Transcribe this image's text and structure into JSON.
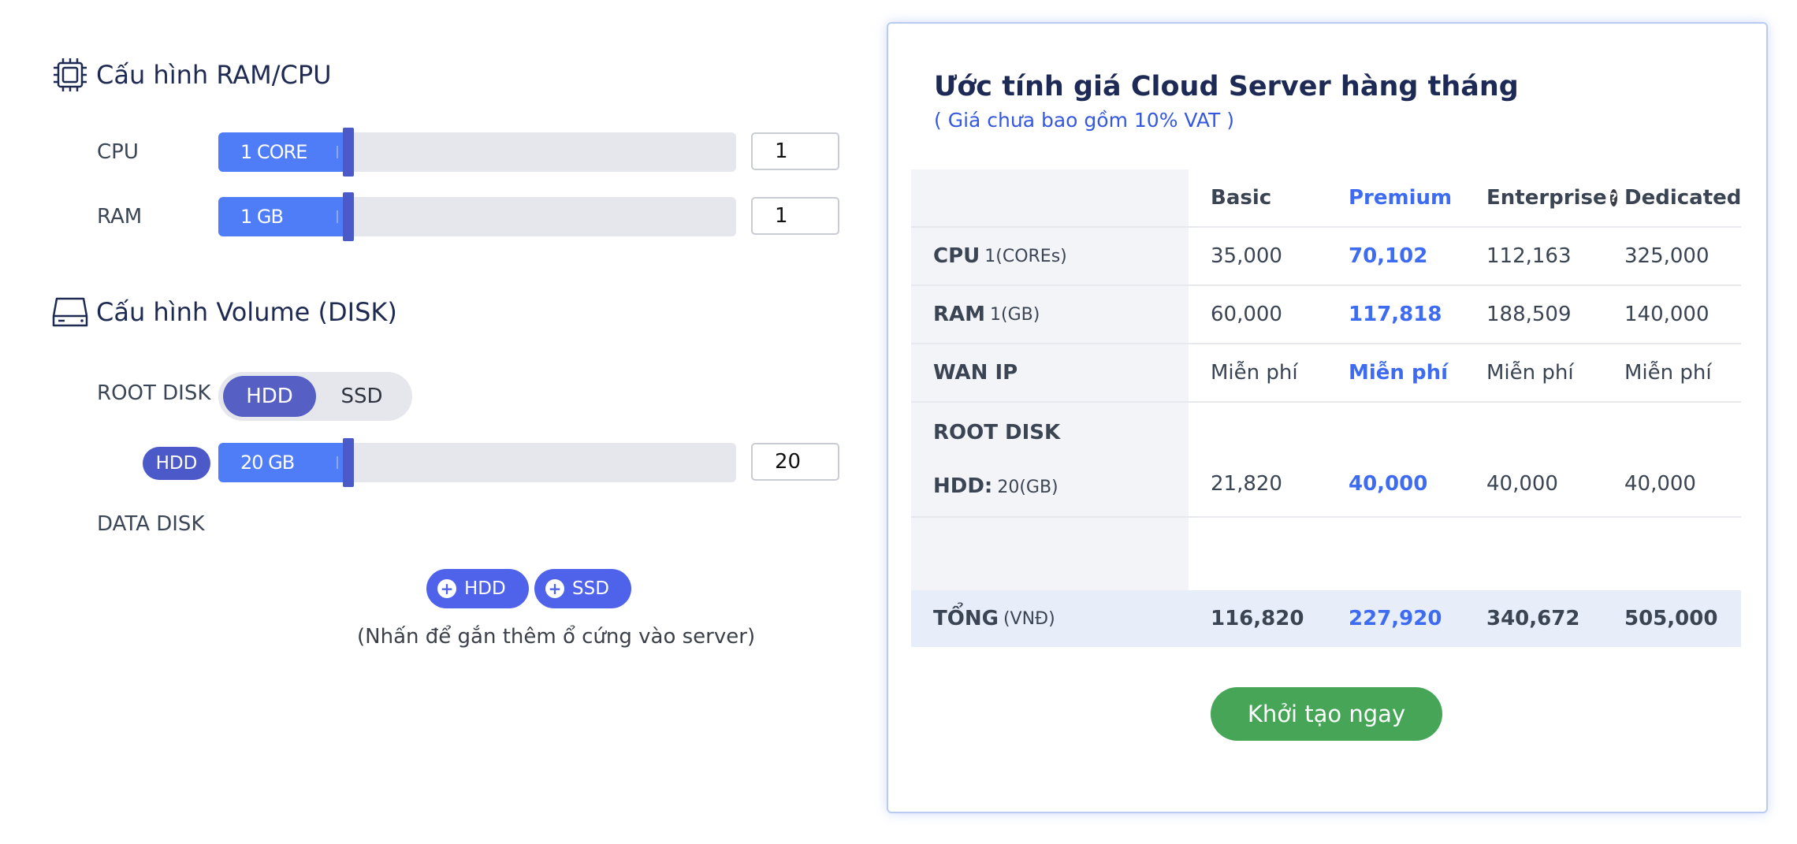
{
  "ram_cpu": {
    "title": "Cấu hình RAM/CPU",
    "cpu": {
      "label": "CPU",
      "fill_text": "1 CORE",
      "value": "1",
      "fraction": 0.25
    },
    "ram": {
      "label": "RAM",
      "fill_text": "1 GB",
      "value": "1",
      "fraction": 0.25
    }
  },
  "volume": {
    "title": "Cấu hình Volume (DISK)",
    "root_disk": {
      "label": "ROOT DISK",
      "options": [
        "HDD",
        "SSD"
      ],
      "selected": "HDD",
      "tag": "HDD",
      "fill_text": "20 GB",
      "value": "20",
      "fraction": 0.25
    },
    "data_disk": {
      "label": "DATA DISK",
      "add_hdd": "HDD",
      "add_ssd": "SSD",
      "hint": "(Nhấn để gắn thêm ổ cứng vào server)"
    }
  },
  "estimate": {
    "title": "Ước tính giá Cloud Server hàng tháng",
    "subtitle": "( Giá chưa bao gồm 10% VAT )",
    "plans": [
      "Basic",
      "Premium",
      "Enterprise",
      "Dedicated"
    ],
    "help_icon": "?",
    "rows": {
      "cpu": {
        "label": "CPU",
        "unit": "1(COREs)",
        "values": [
          "35,000",
          "70,102",
          "112,163",
          "325,000"
        ]
      },
      "ram": {
        "label": "RAM",
        "unit": "1(GB)",
        "values": [
          "60,000",
          "117,818",
          "188,509",
          "140,000"
        ]
      },
      "wan": {
        "label": "WAN IP",
        "values": [
          "Miễn phí",
          "Miễn phí",
          "Miễn phí",
          "Miễn phí"
        ]
      },
      "root": {
        "label": "ROOT DISK",
        "sub_label": "HDD:",
        "sub_unit": "20(GB)",
        "values": [
          "21,820",
          "40,000",
          "40,000",
          "40,000"
        ]
      },
      "total": {
        "label": "TỔNG",
        "unit": "(VNĐ)",
        "values": [
          "116,820",
          "227,920",
          "340,672",
          "505,000"
        ]
      }
    },
    "cta": "Khởi tạo ngay"
  },
  "colors": {
    "accent": "#4f7cf7",
    "handle": "#4b59c9",
    "premium": "#3d6bf2",
    "cta": "#46a556",
    "title": "#1d2a56"
  }
}
